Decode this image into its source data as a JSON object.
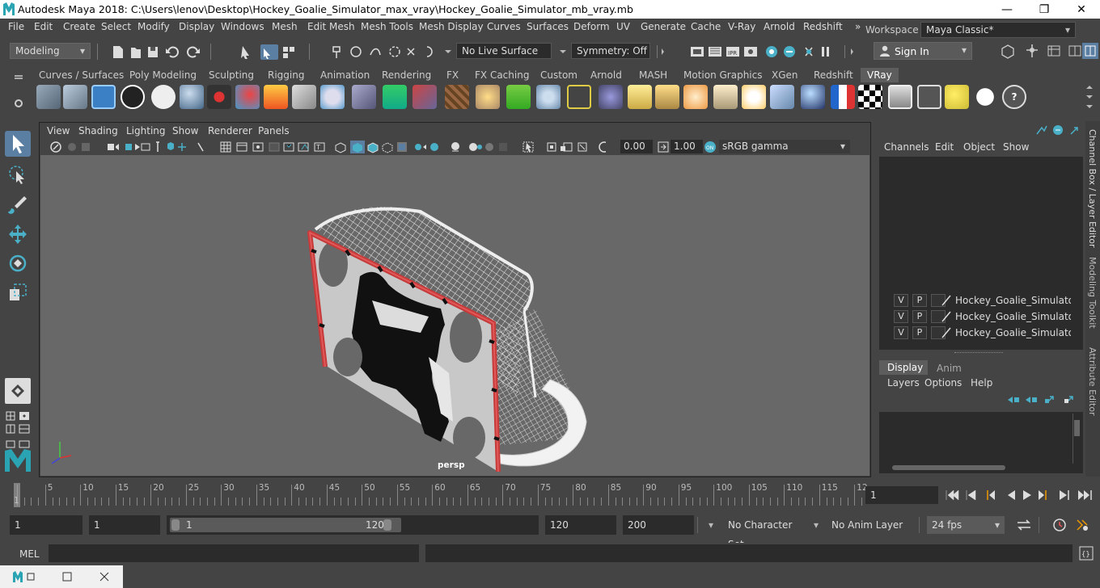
{
  "window": {
    "title": "Autodesk Maya 2018: C:\\Users\\lenov\\Desktop\\Hockey_Goalie_Simulator_max_vray\\Hockey_Goalie_Simulator_mb_vray.mb",
    "minimize": "—",
    "maximize": "❐",
    "close": "✕"
  },
  "menubar": {
    "items": [
      "File",
      "Edit",
      "Create",
      "Select",
      "Modify",
      "Display",
      "Windows",
      "Mesh",
      "Edit Mesh",
      "Mesh Tools",
      "Mesh Display",
      "Curves",
      "Surfaces",
      "Deform",
      "UV",
      "Generate",
      "Cache",
      "V-Ray",
      "Arnold",
      "Redshift"
    ],
    "more": "»",
    "workspace_label": "Workspace :",
    "workspace_value": "Maya Classic*"
  },
  "statusline": {
    "mode": "Modeling",
    "live_surface": "No Live Surface",
    "symmetry": "Symmetry: Off",
    "sign_in": "Sign In"
  },
  "shelf": {
    "tabs": [
      "Curves / Surfaces",
      "Poly Modeling",
      "Sculpting",
      "Rigging",
      "Animation",
      "Rendering",
      "FX",
      "FX Caching",
      "Custom",
      "Arnold",
      "MASH",
      "Motion Graphics",
      "XGen",
      "Redshift",
      "VRay"
    ],
    "active_tab": "VRay"
  },
  "panel": {
    "menus": [
      "View",
      "Shading",
      "Lighting",
      "Show",
      "Renderer",
      "Panels"
    ],
    "exposure": "0.00",
    "gamma": "1.00",
    "color_space": "sRGB gamma",
    "camera_label": "persp"
  },
  "channelbox": {
    "menus": [
      "Channels",
      "Edit",
      "Object",
      "Show"
    ]
  },
  "layereditor": {
    "tabs": [
      "Display",
      "Anim"
    ],
    "active_tab": "Display",
    "menus": [
      "Layers",
      "Options",
      "Help"
    ],
    "layers": [
      {
        "v": "V",
        "p": "P",
        "name": "Hockey_Goalie_Simulator_la"
      },
      {
        "v": "V",
        "p": "P",
        "name": "Hockey_Goalie_Simulator_la"
      },
      {
        "v": "V",
        "p": "P",
        "name": "Hockey_Goalie_Simulator_la"
      }
    ]
  },
  "sidetabs": [
    "Channel Box / Layer Editor",
    "Modeling Toolkit",
    "Attribute Editor"
  ],
  "timeline": {
    "ticks": [
      "1",
      "5",
      "10",
      "15",
      "20",
      "25",
      "30",
      "35",
      "40",
      "45",
      "50",
      "55",
      "60",
      "65",
      "70",
      "75",
      "80",
      "85",
      "90",
      "95",
      "100",
      "105",
      "110",
      "115",
      "12"
    ],
    "current_frame": "1"
  },
  "range": {
    "start": "1",
    "playback_start": "1",
    "slider_start": "1",
    "slider_end": "120",
    "playback_end": "120",
    "end": "200",
    "character_set": "No Character Set",
    "anim_layer": "No Anim Layer",
    "fps": "24 fps"
  },
  "cmdline": {
    "label": "MEL"
  }
}
